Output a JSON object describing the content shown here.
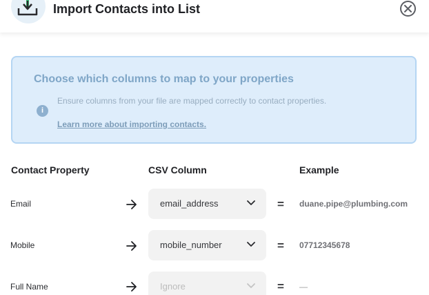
{
  "header": {
    "title": "Import Contacts into List",
    "icon": "download-icon",
    "close_icon": "close-icon"
  },
  "info": {
    "title": "Choose which columns to map to your properties",
    "text": "Ensure columns from your file are mapped correctly to contact properties.",
    "link": "Learn more about importing contacts.",
    "icon_glyph": "i"
  },
  "table": {
    "headers": {
      "property": "Contact Property",
      "csv": "CSV Column",
      "example": "Example"
    },
    "rows": [
      {
        "property": "Email",
        "csv": "email_address",
        "equals": "=",
        "example": "duane.pipe@plumbing.com"
      },
      {
        "property": "Mobile",
        "csv": "mobile_number",
        "equals": "=",
        "example": "07712345678"
      },
      {
        "property": "Full Name",
        "csv": "Ignore",
        "equals": "=",
        "example": "—"
      }
    ]
  },
  "colors": {
    "info_bg": "#deedfb",
    "info_border": "#b4d5f3",
    "icon_green": "#3fd07a",
    "select_bg": "#f2f2f2"
  }
}
